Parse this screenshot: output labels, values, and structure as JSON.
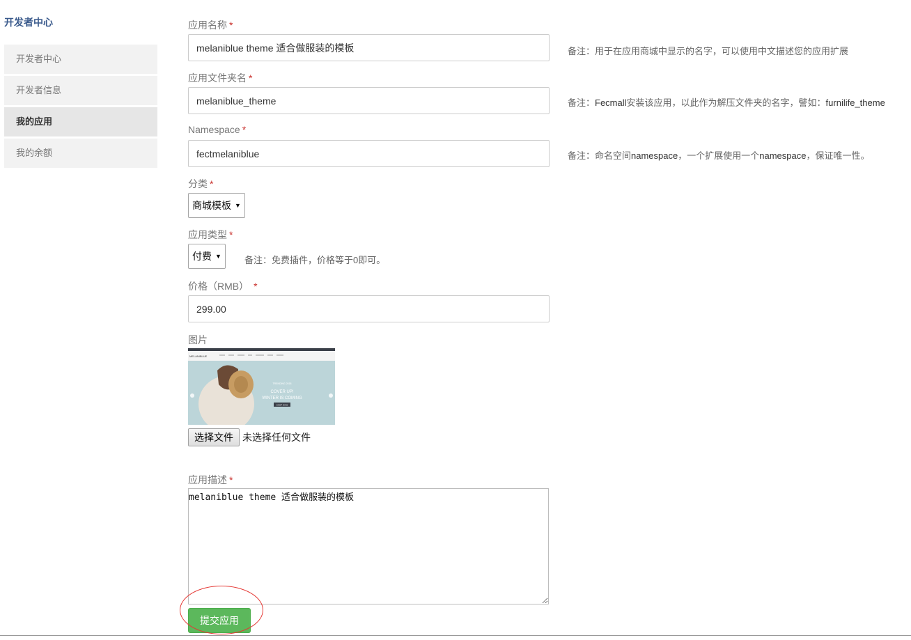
{
  "sidebar": {
    "title": "开发者中心",
    "items": [
      {
        "label": "开发者中心"
      },
      {
        "label": "开发者信息"
      },
      {
        "label": "我的应用"
      },
      {
        "label": "我的余额"
      }
    ]
  },
  "form": {
    "required_mark": "*",
    "app_name": {
      "label": "应用名称",
      "value": "melaniblue theme 适合做服装的模板",
      "note": "备注：用于在应用商城中显示的名字，可以使用中文描述您的应用扩展"
    },
    "folder_name": {
      "label": "应用文件夹名",
      "value": "melaniblue_theme",
      "note_prefix": "备注：",
      "note_hl1": "Fecmall",
      "note_mid": "安装该应用，以此作为解压文件夹的名字，譬如：",
      "note_hl2": "furnilife_theme"
    },
    "namespace": {
      "label": "Namespace",
      "value": "fectmelaniblue",
      "note_prefix": "备注：命名空间",
      "note_hl1": "namespace",
      "note_mid": "，一个扩展使用一个",
      "note_hl2": "namespace",
      "note_suffix": "，保证唯一性。"
    },
    "category": {
      "label": "分类",
      "selected": "商城模板"
    },
    "app_type": {
      "label": "应用类型",
      "selected": "付费",
      "note": "备注：免费插件，价格等于0即可。"
    },
    "price": {
      "label": "价格（RMB）",
      "value": "299.00"
    },
    "image": {
      "label": "图片",
      "choose_label": "选择文件",
      "status": "未选择任何文件",
      "preview_logo": "MELANIBLUE",
      "preview_kicker": "TRENDING 2018",
      "preview_heading1": "COVER UP!",
      "preview_heading2": "WINTER IS COMING",
      "preview_cta": "SHOP NOW"
    },
    "description": {
      "label": "应用描述",
      "value": "melaniblue theme 适合做服装的模板"
    },
    "submit_label": "提交应用"
  },
  "colors": {
    "accent": "#5cb85c",
    "sidebar_title": "#3a5a8c",
    "required": "#c9302c",
    "highlight_circle": "#e53935"
  }
}
